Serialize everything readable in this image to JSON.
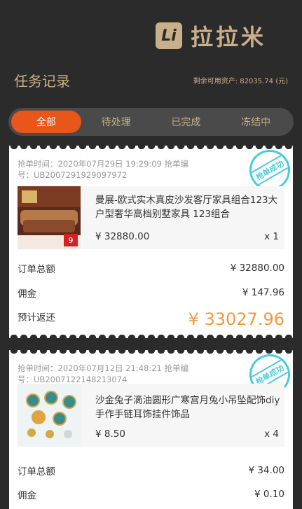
{
  "logo": {
    "mark": "Li",
    "text": "拉拉米"
  },
  "page": {
    "title": "任务记录",
    "balance": "剩余可用资产: 82035.74 (元)"
  },
  "tabs": [
    {
      "label": "全部",
      "active": true
    },
    {
      "label": "待处理",
      "active": false
    },
    {
      "label": "已完成",
      "active": false
    },
    {
      "label": "冻结中",
      "active": false
    }
  ],
  "orders": [
    {
      "meta": "抢单时间：2020年07月29日 19:29:09 抢单编号：UB2007291929097972",
      "stamp": "抢单成功",
      "thumb_icon": "sofa-product-image",
      "product_name": "曼展-欧式实木真皮沙发客厅家具组合123大户型奢华高档别墅家具 123组合",
      "price": "¥ 32880.00",
      "qty": "x 1",
      "total_label": "订单总额",
      "total_value": "¥ 32880.00",
      "commission_label": "佣金",
      "commission_value": "¥ 147.96",
      "refund_label": "预计返还",
      "refund_value": "¥ 33027.96"
    },
    {
      "meta": "抢单时间：2020年07月12日 21:48:21 抢单编号：UB2007122148213074",
      "stamp": "抢单成功",
      "thumb_icon": "pendant-product-image",
      "product_name": "沙金兔子滴油圆形广寒宫月兔小吊坠配饰diy手作手链耳饰挂件饰品",
      "price": "¥ 8.50",
      "qty": "x 4",
      "total_label": "订单总额",
      "total_value": "¥ 34.00",
      "commission_label": "佣金",
      "commission_value": "¥ 0.10"
    }
  ],
  "colors": {
    "bg": "#2b2b2b",
    "gold": "#c9b08a",
    "active_tab": "#e9561a",
    "refund": "#f09a3c",
    "stamp": "#27c4d6"
  }
}
